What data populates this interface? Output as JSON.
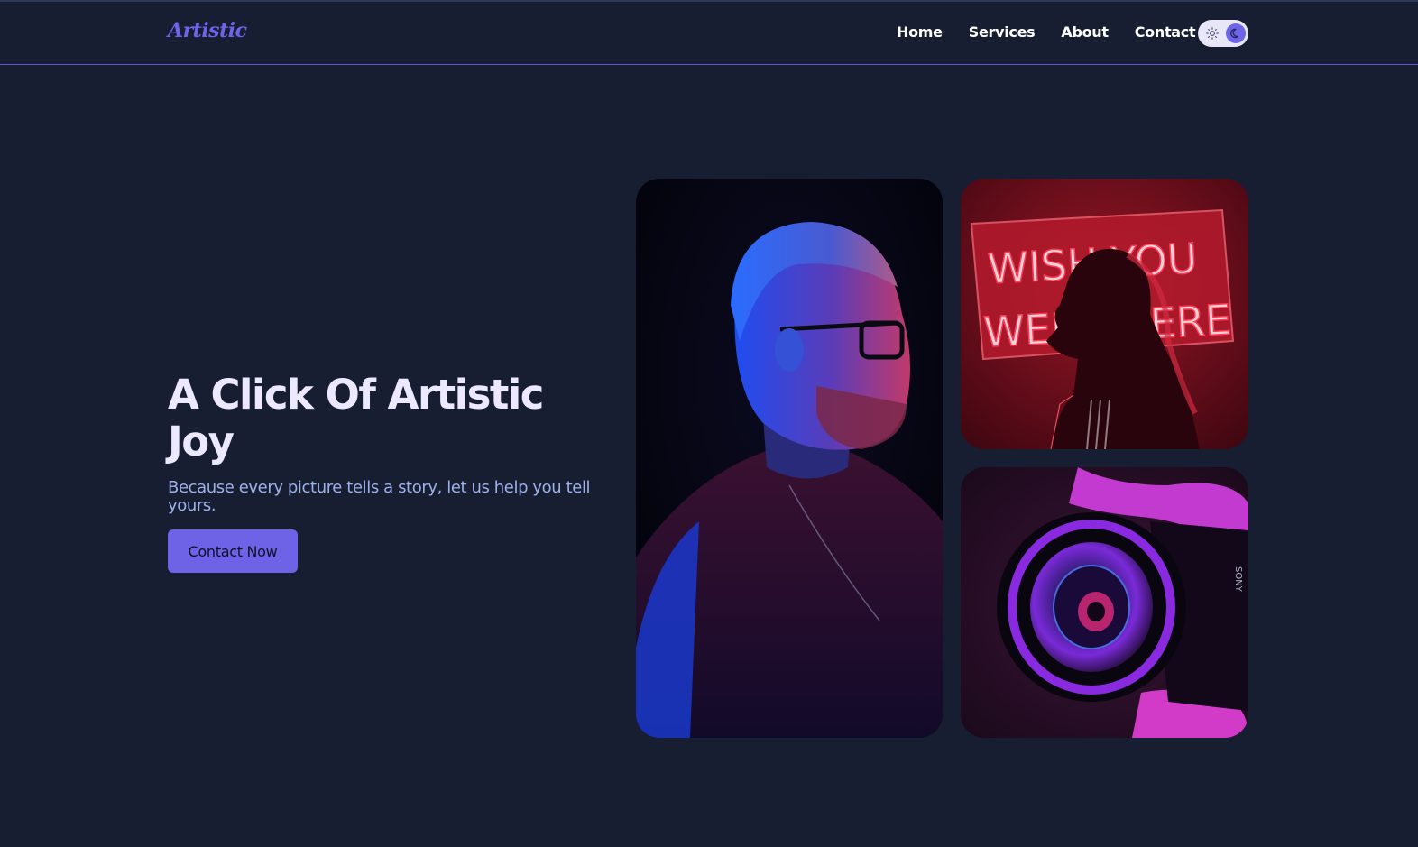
{
  "header": {
    "logo": "Artistic",
    "nav": [
      "Home",
      "Services",
      "About",
      "Contact"
    ],
    "theme_toggle": {
      "light_icon": "sun-icon",
      "dark_icon": "moon-icon",
      "active": "dark"
    }
  },
  "hero": {
    "title": "A Click Of Artistic Joy",
    "subtitle": "Because every picture tells a story, let us help you tell yours.",
    "cta_label": "Contact Now"
  },
  "gallery": {
    "images": [
      {
        "subject": "man-portrait-blue-light"
      },
      {
        "subject": "woman-neon-sign",
        "sign_text": [
          "WISH YOU",
          "WERE HERE"
        ]
      },
      {
        "subject": "camera-lens-purple",
        "brand": "SONY"
      }
    ]
  },
  "colors": {
    "background": "#171e31",
    "accent": "#6e62e6",
    "title": "#ece9ff",
    "subtitle": "#9fb1ea"
  }
}
